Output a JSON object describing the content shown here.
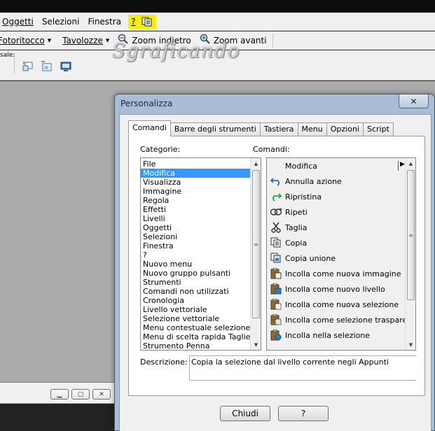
{
  "menubar": {
    "items": [
      "Oggetti",
      "Selezioni",
      "Finestra",
      "?"
    ],
    "extra_icon": "clipboard-icon"
  },
  "toolbar": {
    "fotoritocco_label": "Fotoritocco",
    "tavolozze_label": "Tavolozze",
    "zoom_indietro_label": "Zoom indietro",
    "zoom_avanti_label": "Zoom avanti",
    "scale_label": "sale:"
  },
  "watermark": "Sgraficando",
  "dialog": {
    "title": "Personalizza",
    "close_glyph": "✕",
    "tabs": [
      "Comandi",
      "Barre degli strumenti",
      "Tastiera",
      "Menu",
      "Opzioni",
      "Script"
    ],
    "categorie_label": "Categorie:",
    "comandi_label": "Comandi:",
    "categories": [
      "File",
      "Modifica",
      "Visualizza",
      "Immagine",
      "Regola",
      "Effetti",
      "Livelli",
      "Oggetti",
      "Selezioni",
      "Finestra",
      "?",
      "Nuovo menu",
      "Nuovo gruppo pulsanti",
      "Strumenti",
      "Comandi non utilizzati",
      "Cronologia",
      "Livello vettoriale",
      "Selezione vettoriale",
      "Menu contestuale selezione raster",
      "Menu di scelta rapida Taglierina",
      "Strumento Penna"
    ],
    "selected_category": "Modifica",
    "commands": [
      {
        "label": "Modifica",
        "icon": "none"
      },
      {
        "label": "Annulla azione",
        "icon": "undo-icon"
      },
      {
        "label": "Ripristina",
        "icon": "redo-icon"
      },
      {
        "label": "Ripeti",
        "icon": "repeat-icon"
      },
      {
        "label": "Taglia",
        "icon": "scissors-icon"
      },
      {
        "label": "Copia",
        "icon": "copy-icon"
      },
      {
        "label": "Copia unione",
        "icon": "copy-merged-icon"
      },
      {
        "label": "Incolla come nuova immagine",
        "icon": "paste-new-image-icon"
      },
      {
        "label": "Incolla come nuovo livello",
        "icon": "paste-new-layer-icon"
      },
      {
        "label": "Incolla come nuova selezione",
        "icon": "paste-new-selection-icon"
      },
      {
        "label": "Incolla come selezione trasparente",
        "icon": "paste-transparent-icon"
      },
      {
        "label": "Incolla nella selezione",
        "icon": "paste-into-selection-icon"
      }
    ],
    "descrizione_label": "Descrizione:",
    "descrizione_text": "Copia la selezione dal livello corrente negli Appunti",
    "chiudi_label": "Chiudi",
    "help_label": "?"
  },
  "colors": {
    "highlight_yellow": "#f4f000",
    "selection_blue": "#3399ff",
    "workspace_gray": "#ababab",
    "dialog_frame": "#a9bdd6"
  }
}
